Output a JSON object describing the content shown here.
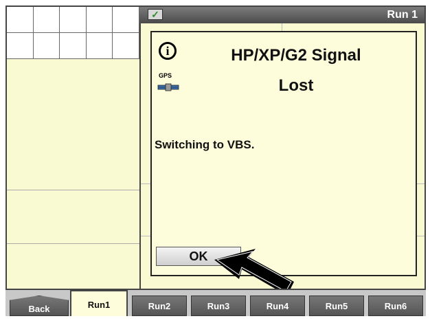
{
  "status": {
    "title": "Run 1",
    "indicator_icon": "check-icon"
  },
  "dialog": {
    "icon": "info-icon",
    "gps_label": "GPS",
    "title_line1": "HP/XP/G2 Signal",
    "title_line2": "Lost",
    "message": "Switching to VBS.",
    "ok_label": "OK"
  },
  "tabs": {
    "back": "Back",
    "run1": "Run1",
    "run2": "Run2",
    "run3": "Run3",
    "run4": "Run4",
    "run5": "Run5",
    "run6": "Run6"
  }
}
